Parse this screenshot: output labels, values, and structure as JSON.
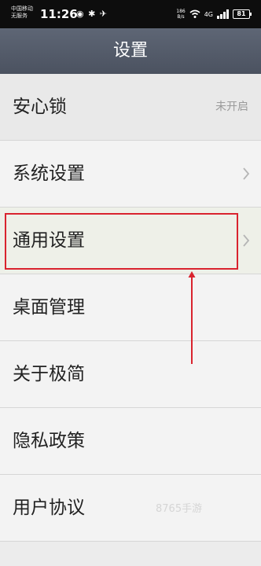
{
  "status_bar": {
    "carrier_line1": "中国移动",
    "carrier_line2": "无服务",
    "time": "11:26",
    "left_icons": "◉ ✱ ✈",
    "net_speed": "186",
    "net_speed_unit": "B/s",
    "network_type": "4G",
    "battery": "81"
  },
  "header": {
    "title": "设置"
  },
  "settings": {
    "items": [
      {
        "label": "安心锁",
        "value": "未开启"
      },
      {
        "label": "系统设置"
      },
      {
        "label": "通用设置"
      },
      {
        "label": "桌面管理"
      },
      {
        "label": "关于极简"
      },
      {
        "label": "隐私政策"
      },
      {
        "label": "用户协议"
      }
    ]
  },
  "annotation": {
    "highlight_color": "#d9232e"
  },
  "watermark": {
    "text": "8765手游"
  },
  "colors": {
    "title_bar": "#545b69",
    "list_bg": "#f3f3f3"
  }
}
